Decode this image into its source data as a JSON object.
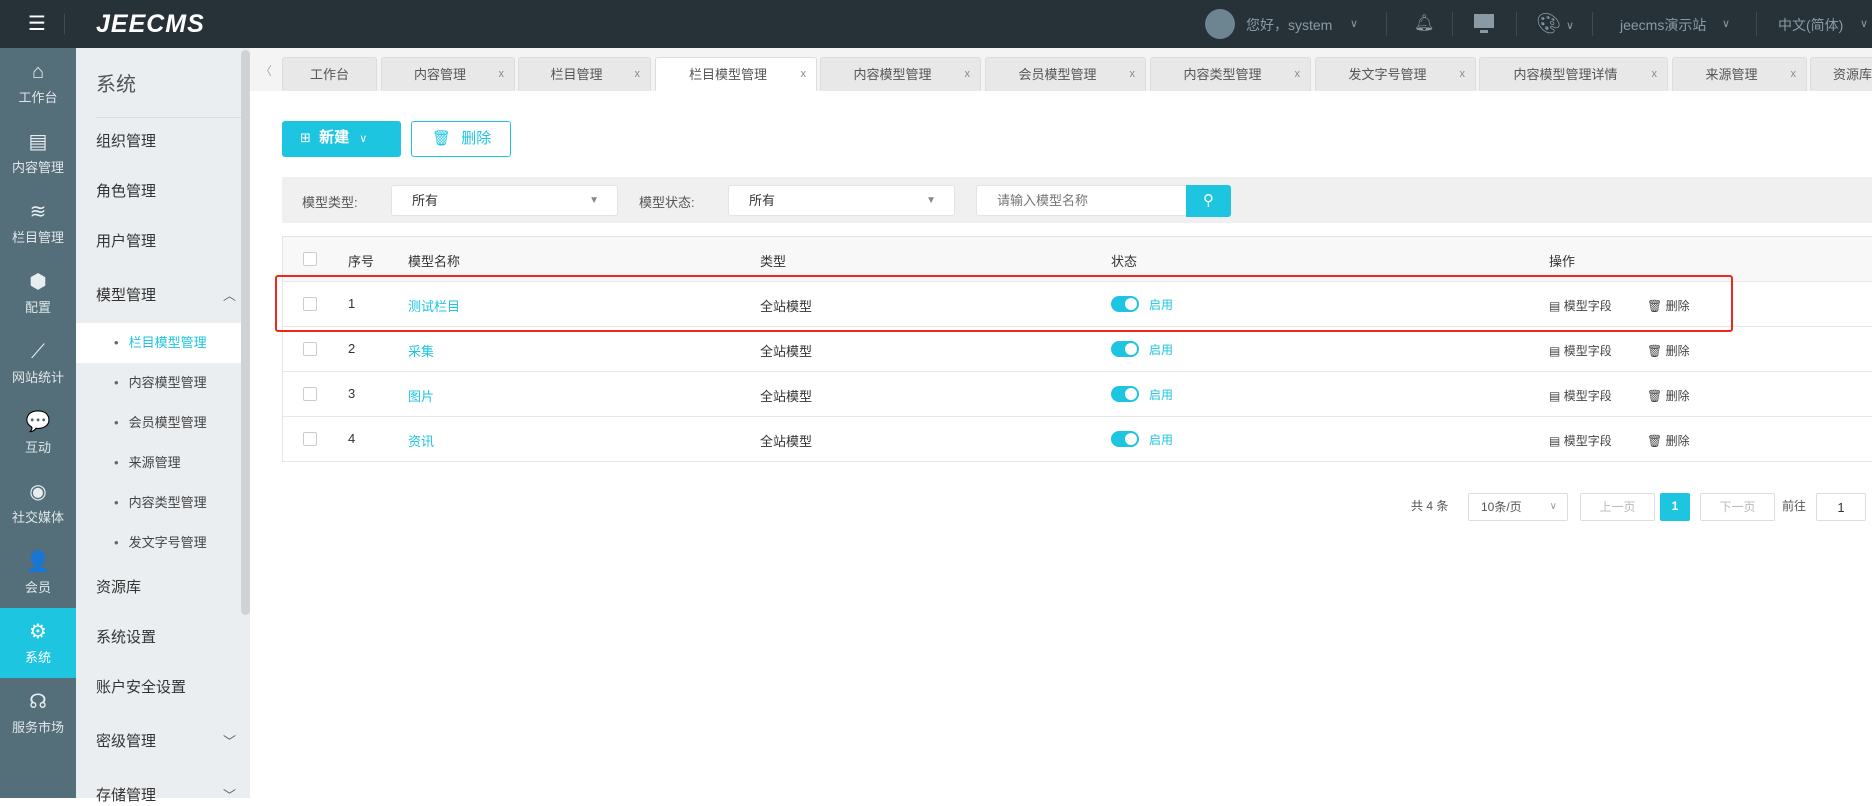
{
  "header": {
    "logo": "JEECMS",
    "greeting": "您好，system",
    "site": "jeecms演示站",
    "language": "中文(简体)"
  },
  "iconbar": [
    {
      "label": "工作台",
      "icon": "⌂"
    },
    {
      "label": "内容管理",
      "icon": "▤"
    },
    {
      "label": "栏目管理",
      "icon": "≋"
    },
    {
      "label": "配置",
      "icon": "⬢"
    },
    {
      "label": "网站统计",
      "icon": "⟋"
    },
    {
      "label": "互动",
      "icon": "💬"
    },
    {
      "label": "社交媒体",
      "icon": "◉"
    },
    {
      "label": "会员",
      "icon": "👤"
    },
    {
      "label": "系统",
      "icon": "⚙"
    },
    {
      "label": "服务市场",
      "icon": "☊"
    }
  ],
  "submenu": {
    "title": "系统",
    "items": [
      "组织管理",
      "角色管理",
      "用户管理",
      "模型管理"
    ],
    "sub_items": [
      "栏目模型管理",
      "内容模型管理",
      "会员模型管理",
      "来源管理",
      "内容类型管理",
      "发文字号管理"
    ],
    "items_after": [
      "资源库",
      "系统设置",
      "账户安全设置",
      "密级管理",
      "存储管理"
    ]
  },
  "tabs": [
    "工作台",
    "内容管理",
    "栏目管理",
    "栏目模型管理",
    "内容模型管理",
    "会员模型管理",
    "内容类型管理",
    "发文字号管理",
    "内容模型管理详情",
    "来源管理",
    "资源库"
  ],
  "toolbar": {
    "new_label": "新建",
    "delete_label": "删除"
  },
  "filter": {
    "type_label": "模型类型:",
    "type_value": "所有",
    "status_label": "模型状态:",
    "status_value": "所有",
    "search_placeholder": "请输入模型名称"
  },
  "table": {
    "headers": [
      "序号",
      "模型名称",
      "类型",
      "状态",
      "操作"
    ],
    "rows": [
      {
        "no": "1",
        "name": "测试栏目",
        "type": "全站模型",
        "status": "启用"
      },
      {
        "no": "2",
        "name": "采集",
        "type": "全站模型",
        "status": "启用"
      },
      {
        "no": "3",
        "name": "图片",
        "type": "全站模型",
        "status": "启用"
      },
      {
        "no": "4",
        "name": "资讯",
        "type": "全站模型",
        "status": "启用"
      }
    ],
    "action_fields": "模型字段",
    "action_delete": "删除"
  },
  "pagination": {
    "total": "共 4 条",
    "page_size": "10条/页",
    "prev": "上一页",
    "current": "1",
    "next": "下一页",
    "goto_label": "前往",
    "goto_value": "1"
  }
}
